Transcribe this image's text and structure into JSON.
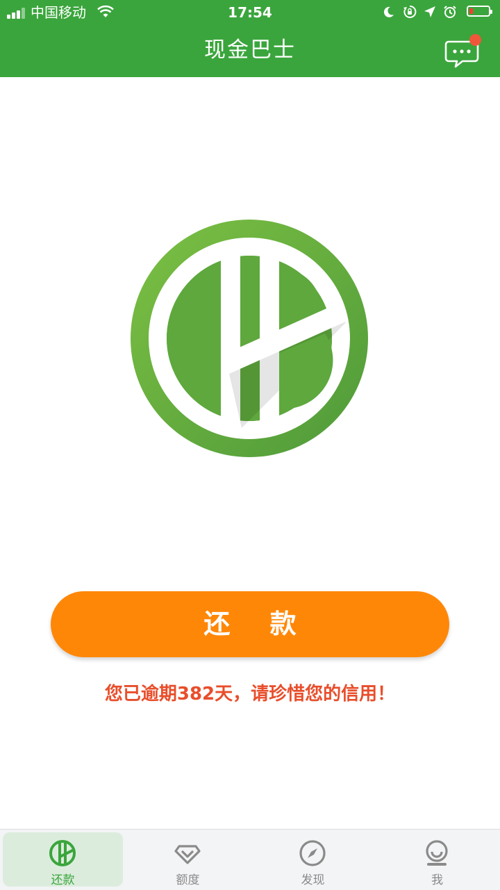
{
  "status_bar": {
    "carrier": "中国移动",
    "time": "17:54"
  },
  "header": {
    "title": "现金巴士"
  },
  "main": {
    "repay_button": "还 款",
    "overdue_notice": "您已逾期382天，请珍惜您的信用！"
  },
  "tabs": [
    {
      "label": "还款",
      "icon": "cb-logo-icon",
      "active": true
    },
    {
      "label": "额度",
      "icon": "diamond-icon",
      "active": false
    },
    {
      "label": "发现",
      "icon": "compass-icon",
      "active": false
    },
    {
      "label": "我",
      "icon": "profile-icon",
      "active": false
    }
  ],
  "colors": {
    "brand_green": "#3aa53c",
    "button_orange": "#ff8708",
    "warning_red": "#e84e2b",
    "badge_red": "#f0573a"
  }
}
